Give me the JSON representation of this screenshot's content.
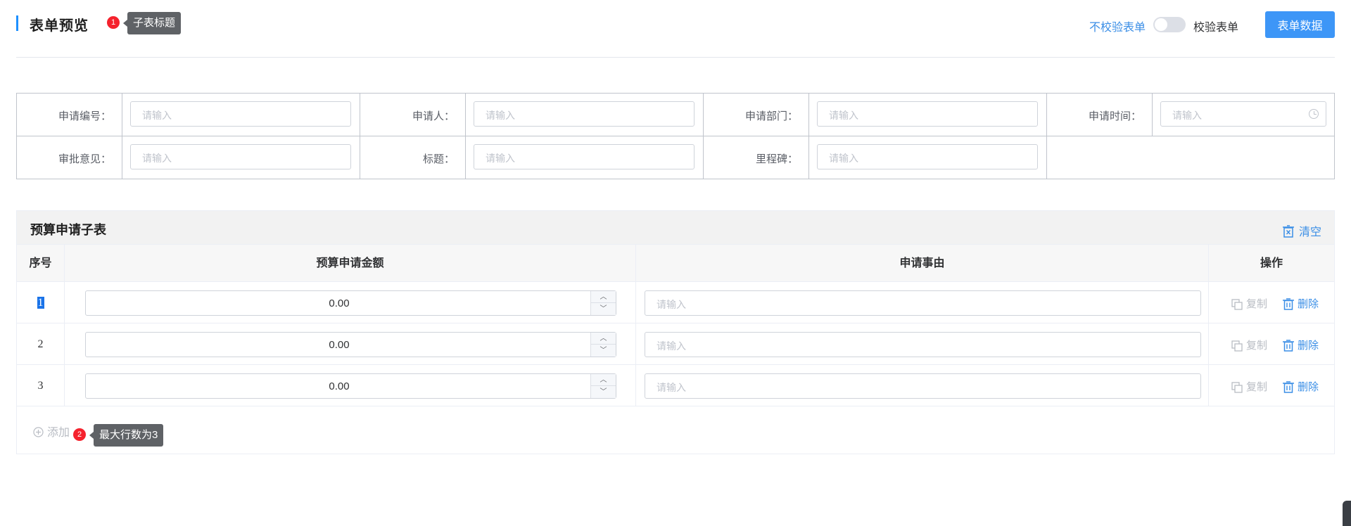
{
  "header": {
    "title": "表单预览",
    "badge_1": "1",
    "tip_1": "子表标题",
    "no_validate_label": "不校验表单",
    "validate_label": "校验表单",
    "data_button": "表单数据"
  },
  "form": {
    "fields": [
      {
        "label": "申请编号：",
        "placeholder": "请输入"
      },
      {
        "label": "申请人：",
        "placeholder": "请输入"
      },
      {
        "label": "申请部门：",
        "placeholder": "请输入"
      },
      {
        "label": "申请时间：",
        "placeholder": "请输入"
      },
      {
        "label": "审批意见：",
        "placeholder": "请输入"
      },
      {
        "label": "标题：",
        "placeholder": "请输入"
      },
      {
        "label": "里程碑：",
        "placeholder": "请输入"
      }
    ]
  },
  "subtable": {
    "title": "预算申请子表",
    "clear_label": "清空",
    "columns": [
      "序号",
      "预算申请金额",
      "申请事由",
      "操作"
    ],
    "rows": [
      {
        "seq": "1",
        "amount": "0.00",
        "reason_placeholder": "请输入"
      },
      {
        "seq": "2",
        "amount": "0.00",
        "reason_placeholder": "请输入"
      },
      {
        "seq": "3",
        "amount": "0.00",
        "reason_placeholder": "请输入"
      }
    ],
    "copy_label": "复制",
    "delete_label": "删除",
    "add_label": "添加",
    "badge_2": "2",
    "tip_2": "最大行数为3"
  },
  "colors": {
    "accent": "#3d96f7",
    "link": "#3a8ee6",
    "badge": "#f5222d"
  }
}
